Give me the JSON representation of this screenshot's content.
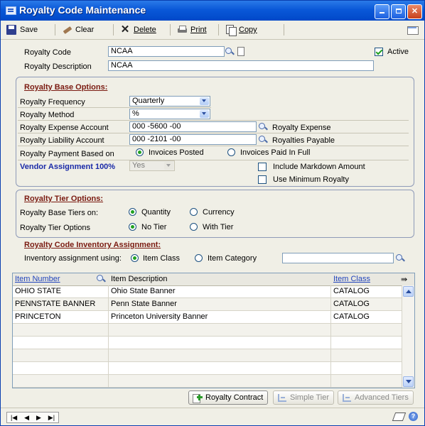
{
  "window": {
    "title": "Royalty Code Maintenance",
    "icon": "window-icon",
    "controls": [
      "minimize",
      "maximize",
      "close"
    ]
  },
  "toolbar": {
    "save_label": "Save",
    "clear_label": "Clear",
    "delete_label": "Delete",
    "print_label": "Print",
    "copy_label": "Copy"
  },
  "header": {
    "royalty_code_label": "Royalty Code",
    "royalty_code_value": "NCAA",
    "royalty_description_label": "Royalty Description",
    "royalty_description_value": "NCAA",
    "active_label": "Active",
    "active_checked": true
  },
  "base_options": {
    "section_title": "Royalty Base Options:",
    "frequency_label": "Royalty Frequency",
    "frequency_value": "Quarterly",
    "method_label": "Royalty Method",
    "method_value": "%",
    "expense_account_label": "Royalty Expense Account",
    "expense_account_value": "000 -5600 -00",
    "expense_account_desc": "Royalty Expense",
    "liability_account_label": "Royalty Liability Account",
    "liability_account_value": "000 -2101 -00",
    "liability_account_desc": "Royalties Payable",
    "payment_based_label": "Royalty Payment Based on",
    "payment_options": [
      "Invoices Posted",
      "Invoices Paid In Full"
    ],
    "payment_selected": "Invoices Posted",
    "vendor_assignment_label": "Vendor Assignment 100%",
    "vendor_assignment_value": "Yes",
    "include_markdown_label": "Include Markdown Amount",
    "include_markdown_checked": false,
    "use_minimum_label": "Use Minimum Royalty",
    "use_minimum_checked": false
  },
  "tier_options": {
    "section_title": "Royalty Tier Options:",
    "base_tiers_label": "Royalty Base Tiers on:",
    "base_tiers_options": [
      "Quantity",
      "Currency"
    ],
    "base_tiers_selected": "Quantity",
    "tier_options_label": "Royalty Tier Options",
    "tier_options_options": [
      "No Tier",
      "With Tier"
    ],
    "tier_options_selected": "No Tier"
  },
  "inventory": {
    "section_title": "Royalty Code Inventory Assignment:",
    "assignment_label": "Inventory assignment using:",
    "assignment_options": [
      "Item Class",
      "Item Category"
    ],
    "assignment_selected": "Item Class",
    "filter_value": ""
  },
  "table": {
    "columns": [
      "Item Number",
      "Item Description",
      "Item Class"
    ],
    "rows": [
      {
        "item_number": "OHIO STATE",
        "description": "Ohio State Banner",
        "item_class": "CATALOG"
      },
      {
        "item_number": "PENNSTATE BANNER",
        "description": "Penn State Banner",
        "item_class": "CATALOG"
      },
      {
        "item_number": "PRINCETON",
        "description": "Princeton University Banner",
        "item_class": "CATALOG"
      }
    ],
    "empty_rows": 5
  },
  "buttons": {
    "royalty_contract": "Royalty Contract",
    "simple_tier": "Simple Tier",
    "advanced_tiers": "Advanced Tiers"
  },
  "colors": {
    "title_bar": "#0a58d8",
    "section_title": "#7a1a10",
    "vendor_label": "#1a2aa8",
    "link": "#2244bb",
    "radio_dot": "#21a121"
  }
}
